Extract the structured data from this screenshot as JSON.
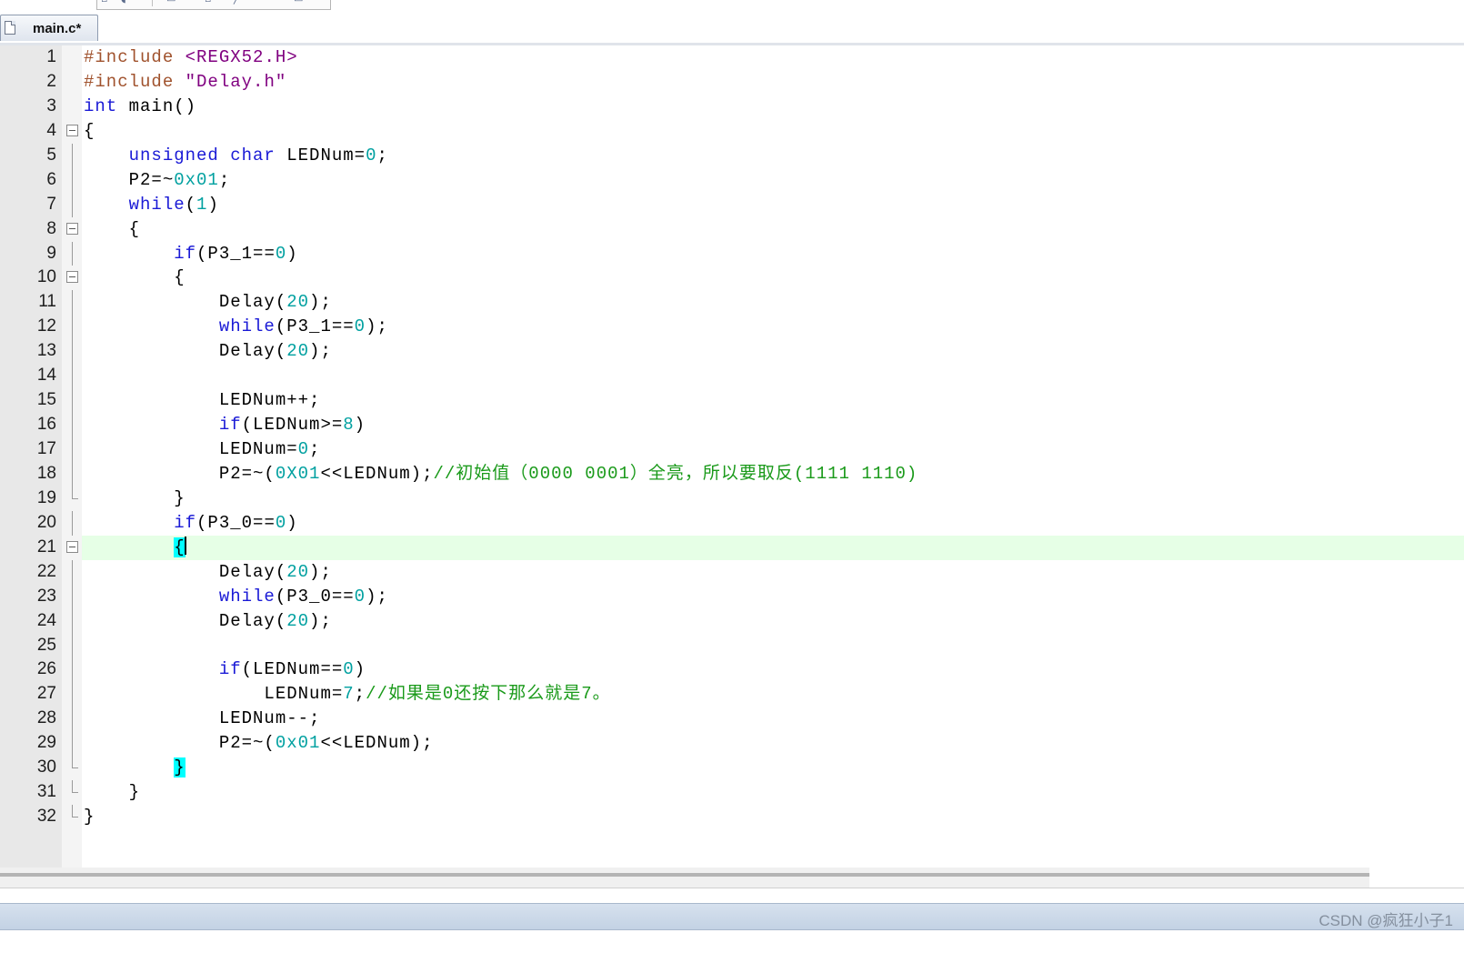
{
  "tabs": [
    {
      "label": "main.c*",
      "active": true
    }
  ],
  "editor": {
    "current_line": 21,
    "lines": [
      {
        "n": "1",
        "tokens": [
          {
            "c": "pp",
            "t": "#include "
          },
          {
            "c": "str",
            "t": "<REGX52.H>"
          }
        ]
      },
      {
        "n": "2",
        "tokens": [
          {
            "c": "pp",
            "t": "#include "
          },
          {
            "c": "str",
            "t": "\"Delay.h\""
          }
        ]
      },
      {
        "n": "3",
        "tokens": [
          {
            "c": "kw",
            "t": "int"
          },
          {
            "c": "",
            "t": " main()"
          }
        ]
      },
      {
        "n": "4",
        "fold": "box",
        "tokens": [
          {
            "c": "",
            "t": "{"
          }
        ]
      },
      {
        "n": "5",
        "fold": "line",
        "tokens": [
          {
            "c": "",
            "t": "    "
          },
          {
            "c": "kw",
            "t": "unsigned char"
          },
          {
            "c": "",
            "t": " LEDNum="
          },
          {
            "c": "num",
            "t": "0"
          },
          {
            "c": "",
            "t": ";"
          }
        ]
      },
      {
        "n": "6",
        "fold": "line",
        "tokens": [
          {
            "c": "",
            "t": "    P2=~"
          },
          {
            "c": "num",
            "t": "0x01"
          },
          {
            "c": "",
            "t": ";"
          }
        ]
      },
      {
        "n": "7",
        "fold": "line",
        "tokens": [
          {
            "c": "",
            "t": "    "
          },
          {
            "c": "kw",
            "t": "while"
          },
          {
            "c": "",
            "t": "("
          },
          {
            "c": "num",
            "t": "1"
          },
          {
            "c": "",
            "t": ")"
          }
        ]
      },
      {
        "n": "8",
        "fold": "box",
        "tokens": [
          {
            "c": "",
            "t": "    {"
          }
        ]
      },
      {
        "n": "9",
        "fold": "line",
        "tokens": [
          {
            "c": "",
            "t": "        "
          },
          {
            "c": "kw",
            "t": "if"
          },
          {
            "c": "",
            "t": "(P3_1=="
          },
          {
            "c": "num",
            "t": "0"
          },
          {
            "c": "",
            "t": ")"
          }
        ]
      },
      {
        "n": "10",
        "fold": "box",
        "tokens": [
          {
            "c": "",
            "t": "        {"
          }
        ]
      },
      {
        "n": "11",
        "fold": "line",
        "tokens": [
          {
            "c": "",
            "t": "            Delay("
          },
          {
            "c": "num",
            "t": "20"
          },
          {
            "c": "",
            "t": ");"
          }
        ]
      },
      {
        "n": "12",
        "fold": "line",
        "tokens": [
          {
            "c": "",
            "t": "            "
          },
          {
            "c": "kw",
            "t": "while"
          },
          {
            "c": "",
            "t": "(P3_1=="
          },
          {
            "c": "num",
            "t": "0"
          },
          {
            "c": "",
            "t": ");"
          }
        ]
      },
      {
        "n": "13",
        "fold": "line",
        "tokens": [
          {
            "c": "",
            "t": "            Delay("
          },
          {
            "c": "num",
            "t": "20"
          },
          {
            "c": "",
            "t": ");"
          }
        ]
      },
      {
        "n": "14",
        "fold": "line",
        "tokens": [
          {
            "c": "",
            "t": ""
          }
        ]
      },
      {
        "n": "15",
        "fold": "line",
        "tokens": [
          {
            "c": "",
            "t": "            LEDNum++;"
          }
        ]
      },
      {
        "n": "16",
        "fold": "line",
        "tokens": [
          {
            "c": "",
            "t": "            "
          },
          {
            "c": "kw",
            "t": "if"
          },
          {
            "c": "",
            "t": "(LEDNum>="
          },
          {
            "c": "num",
            "t": "8"
          },
          {
            "c": "",
            "t": ")"
          }
        ]
      },
      {
        "n": "17",
        "fold": "line",
        "tokens": [
          {
            "c": "",
            "t": "            LEDNum="
          },
          {
            "c": "num",
            "t": "0"
          },
          {
            "c": "",
            "t": ";"
          }
        ]
      },
      {
        "n": "18",
        "fold": "line",
        "tokens": [
          {
            "c": "",
            "t": "            P2=~("
          },
          {
            "c": "num",
            "t": "0X01"
          },
          {
            "c": "",
            "t": "<<LEDNum);"
          },
          {
            "c": "cm",
            "t": "//初始值（0000 0001）全亮，所以要取反(1111 1110)"
          }
        ]
      },
      {
        "n": "19",
        "fold": "end",
        "tokens": [
          {
            "c": "",
            "t": "        }"
          }
        ]
      },
      {
        "n": "20",
        "fold": "line",
        "tokens": [
          {
            "c": "",
            "t": "        "
          },
          {
            "c": "kw",
            "t": "if"
          },
          {
            "c": "",
            "t": "(P3_0=="
          },
          {
            "c": "num",
            "t": "0"
          },
          {
            "c": "",
            "t": ")"
          }
        ]
      },
      {
        "n": "21",
        "fold": "box",
        "tokens": [
          {
            "c": "",
            "t": "        "
          },
          {
            "c": "cur-brace",
            "t": "{"
          },
          {
            "c": "caret",
            "t": ""
          }
        ]
      },
      {
        "n": "22",
        "fold": "line",
        "tokens": [
          {
            "c": "",
            "t": "            Delay("
          },
          {
            "c": "num",
            "t": "20"
          },
          {
            "c": "",
            "t": ");"
          }
        ]
      },
      {
        "n": "23",
        "fold": "line",
        "tokens": [
          {
            "c": "",
            "t": "            "
          },
          {
            "c": "kw",
            "t": "while"
          },
          {
            "c": "",
            "t": "(P3_0=="
          },
          {
            "c": "num",
            "t": "0"
          },
          {
            "c": "",
            "t": ");"
          }
        ]
      },
      {
        "n": "24",
        "fold": "line",
        "tokens": [
          {
            "c": "",
            "t": "            Delay("
          },
          {
            "c": "num",
            "t": "20"
          },
          {
            "c": "",
            "t": ");"
          }
        ]
      },
      {
        "n": "25",
        "fold": "line",
        "tokens": [
          {
            "c": "",
            "t": ""
          }
        ]
      },
      {
        "n": "26",
        "fold": "line",
        "tokens": [
          {
            "c": "",
            "t": "            "
          },
          {
            "c": "kw",
            "t": "if"
          },
          {
            "c": "",
            "t": "(LEDNum=="
          },
          {
            "c": "num",
            "t": "0"
          },
          {
            "c": "",
            "t": ")"
          }
        ]
      },
      {
        "n": "27",
        "fold": "line",
        "tokens": [
          {
            "c": "",
            "t": "                LEDNum="
          },
          {
            "c": "num",
            "t": "7"
          },
          {
            "c": "",
            "t": ";"
          },
          {
            "c": "cm",
            "t": "//如果是0还按下那么就是7。"
          }
        ]
      },
      {
        "n": "28",
        "fold": "line",
        "tokens": [
          {
            "c": "",
            "t": "            LEDNum--;"
          }
        ]
      },
      {
        "n": "29",
        "fold": "line",
        "tokens": [
          {
            "c": "",
            "t": "            P2=~("
          },
          {
            "c": "num",
            "t": "0x01"
          },
          {
            "c": "",
            "t": "<<LEDNum);"
          }
        ]
      },
      {
        "n": "30",
        "fold": "end",
        "tokens": [
          {
            "c": "",
            "t": "        "
          },
          {
            "c": "cur-brace",
            "t": "}"
          }
        ]
      },
      {
        "n": "31",
        "fold": "end",
        "tokens": [
          {
            "c": "",
            "t": "    }"
          }
        ]
      },
      {
        "n": "32",
        "fold": "end",
        "tokens": [
          {
            "c": "",
            "t": "}"
          }
        ]
      }
    ]
  },
  "watermark": "CSDN @疯狂小子1",
  "colors": {
    "keyword": "#1a1ad6",
    "preprocessor": "#a0522d",
    "string": "#800080",
    "number": "#00a0a0",
    "comment": "#1a9a1a",
    "current_line_bg": "#e6ffe6",
    "brace_match_bg": "#00ffff"
  }
}
